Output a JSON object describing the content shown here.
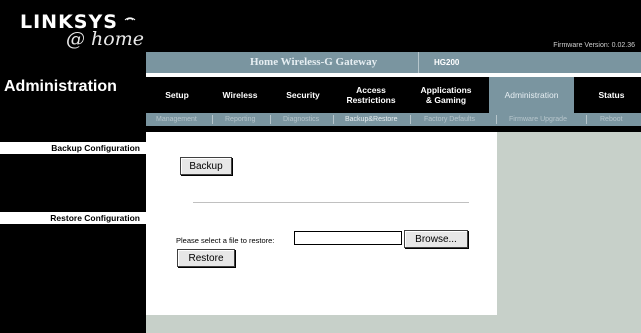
{
  "brand": {
    "logo_main": "LINKSYS",
    "logo_sub": "@ home"
  },
  "section": {
    "title": "Administration"
  },
  "header": {
    "firmware": "Firmware Version: 0.02.36",
    "product_name": "Home Wireless-G Gateway",
    "model": "HG200"
  },
  "nav": {
    "tabs": [
      {
        "label": "Setup"
      },
      {
        "label": "Wireless"
      },
      {
        "label": "Security"
      },
      {
        "label": "Access Restrictions"
      },
      {
        "label": "Applications & Gaming"
      },
      {
        "label": "Administration"
      },
      {
        "label": "Status"
      }
    ],
    "active_tab": "Administration"
  },
  "subnav": {
    "items": [
      {
        "label": "Management"
      },
      {
        "label": "Reporting"
      },
      {
        "label": "Diagnostics"
      },
      {
        "label": "Backup&Restore"
      },
      {
        "label": "Factory Defaults"
      },
      {
        "label": "Firmware Upgrade"
      },
      {
        "label": "Reboot"
      }
    ],
    "active_item": "Backup&Restore"
  },
  "left_labels": {
    "backup": "Backup Configuration",
    "restore": "Restore Configuration"
  },
  "backup": {
    "button_label": "Backup"
  },
  "restore": {
    "file_label": "Please select a file to restore:",
    "file_value": "",
    "browse_label": "Browse...",
    "button_label": "Restore"
  },
  "colors": {
    "accent": "#7a95a0",
    "panel": "#c7d0c9",
    "header_bg": "#000000"
  }
}
